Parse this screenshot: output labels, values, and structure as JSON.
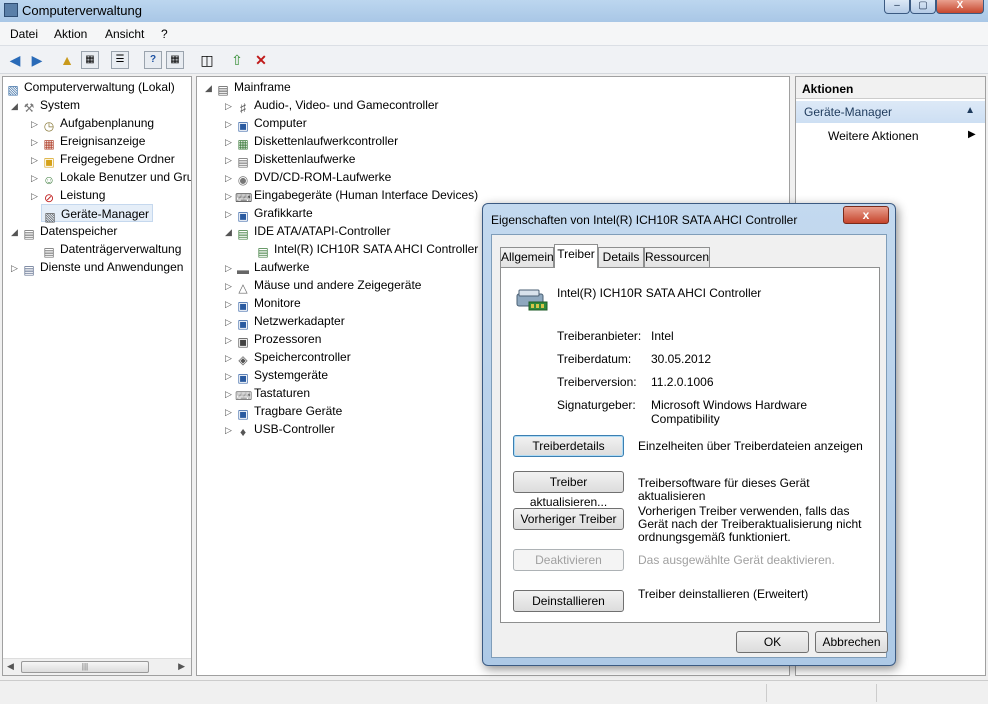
{
  "window": {
    "title": "Computerverwaltung"
  },
  "menu": [
    "Datei",
    "Aktion",
    "Ansicht",
    "?"
  ],
  "left_tree": [
    {
      "label": "Computerverwaltung (Lokal)",
      "icon": "computer-management-icon"
    },
    {
      "label": "System",
      "icon": "tools-icon"
    },
    {
      "label": "Aufgabenplanung",
      "icon": "clock-icon"
    },
    {
      "label": "Ereignisanzeige",
      "icon": "event-viewer-icon"
    },
    {
      "label": "Freigegebene Ordner",
      "icon": "shared-folder-icon"
    },
    {
      "label": "Lokale Benutzer und Gruppen",
      "icon": "users-icon"
    },
    {
      "label": "Leistung",
      "icon": "performance-icon"
    },
    {
      "label": "Geräte-Manager",
      "icon": "device-manager-icon"
    },
    {
      "label": "Datenspeicher",
      "icon": "storage-icon"
    },
    {
      "label": "Datenträgerverwaltung",
      "icon": "disk-management-icon"
    },
    {
      "label": "Dienste und Anwendungen",
      "icon": "services-icon"
    }
  ],
  "device_tree": [
    {
      "label": "Mainframe",
      "icon": "computer-icon"
    },
    {
      "label": "Audio-, Video- und Gamecontroller",
      "icon": "speaker-icon"
    },
    {
      "label": "Computer",
      "icon": "monitor-icon"
    },
    {
      "label": "Diskettenlaufwerkcontroller",
      "icon": "floppy-controller-icon"
    },
    {
      "label": "Diskettenlaufwerke",
      "icon": "floppy-icon"
    },
    {
      "label": "DVD/CD-ROM-Laufwerke",
      "icon": "cdrom-icon"
    },
    {
      "label": "Eingabegeräte (Human Interface Devices)",
      "icon": "hid-icon"
    },
    {
      "label": "Grafikkarte",
      "icon": "display-adapter-icon"
    },
    {
      "label": "IDE ATA/ATAPI-Controller",
      "icon": "ide-controller-icon"
    },
    {
      "label": "Intel(R) ICH10R SATA AHCI Controller",
      "icon": "ide-controller-icon"
    },
    {
      "label": "Laufwerke",
      "icon": "drive-icon"
    },
    {
      "label": "Mäuse und andere Zeigegeräte",
      "icon": "mouse-icon"
    },
    {
      "label": "Monitore",
      "icon": "monitor-icon"
    },
    {
      "label": "Netzwerkadapter",
      "icon": "network-icon"
    },
    {
      "label": "Prozessoren",
      "icon": "cpu-icon"
    },
    {
      "label": "Speichercontroller",
      "icon": "storage-controller-icon"
    },
    {
      "label": "Systemgeräte",
      "icon": "system-device-icon"
    },
    {
      "label": "Tastaturen",
      "icon": "keyboard-icon"
    },
    {
      "label": "Tragbare Geräte",
      "icon": "portable-device-icon"
    },
    {
      "label": "USB-Controller",
      "icon": "usb-icon"
    }
  ],
  "actions": {
    "header": "Aktionen",
    "section": "Geräte-Manager",
    "more": "Weitere Aktionen"
  },
  "dialog": {
    "title": "Eigenschaften von Intel(R) ICH10R SATA AHCI Controller",
    "tabs": [
      "Allgemein",
      "Treiber",
      "Details",
      "Ressourcen"
    ],
    "active_tab": "Treiber",
    "device_name": "Intel(R) ICH10R SATA AHCI Controller",
    "fields": [
      {
        "label": "Treiberanbieter:",
        "value": "Intel"
      },
      {
        "label": "Treiberdatum:",
        "value": "30.05.2012"
      },
      {
        "label": "Treiberversion:",
        "value": "11.2.0.1006"
      },
      {
        "label": "Signaturgeber:",
        "value": "Microsoft Windows Hardware Compatibility"
      }
    ],
    "buttons": [
      {
        "label": "Treiberdetails",
        "desc": "Einzelheiten über Treiberdateien anzeigen",
        "enabled": true
      },
      {
        "label": "Treiber aktualisieren...",
        "desc": "Treibersoftware für dieses Gerät aktualisieren",
        "enabled": true
      },
      {
        "label": "Vorheriger Treiber",
        "desc": "Vorherigen Treiber verwenden, falls das Gerät nach der Treiberaktualisierung nicht ordnungsgemäß funktioniert.",
        "enabled": true
      },
      {
        "label": "Deaktivieren",
        "desc": "Das ausgewählte Gerät deaktivieren.",
        "enabled": false
      },
      {
        "label": "Deinstallieren",
        "desc": "Treiber deinstallieren (Erweitert)",
        "enabled": true
      }
    ],
    "ok": "OK",
    "cancel": "Abbrechen",
    "close_glyph": "x"
  },
  "window_controls": {
    "minimize": "–",
    "maximize": "▢",
    "close": "X"
  }
}
